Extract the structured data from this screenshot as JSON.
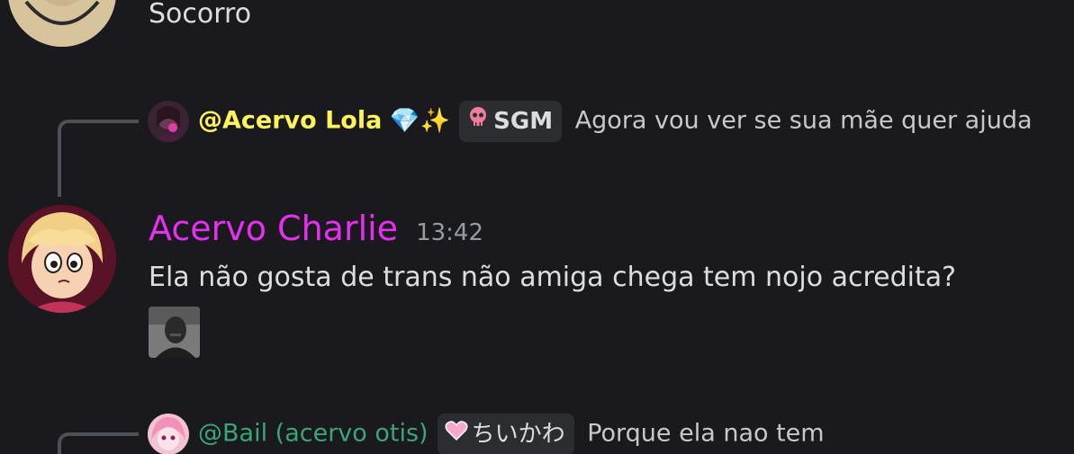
{
  "previous_message": {
    "text": "Socorro"
  },
  "reply1": {
    "author": "@Acervo Lola",
    "author_emoji": "💎✨",
    "tag_icon": "skull-icon",
    "tag_label": "SGM",
    "content": "Agora vou ver se sua mãe quer ajuda",
    "author_color": "#fff35c"
  },
  "message": {
    "username": "Acervo Charlie",
    "username_color": "#e62ff0",
    "timestamp": "13:42",
    "text": "Ela não gosta de trans não amiga chega tem nojo acredita?",
    "attachment": "inline-photo"
  },
  "reply2": {
    "author": "@Bail (acervo otis)",
    "tag_icon": "pink-heart-icon",
    "tag_label": "ちいかわ",
    "content": "Porque ela nao tem",
    "author_color": "#3aa57a"
  }
}
